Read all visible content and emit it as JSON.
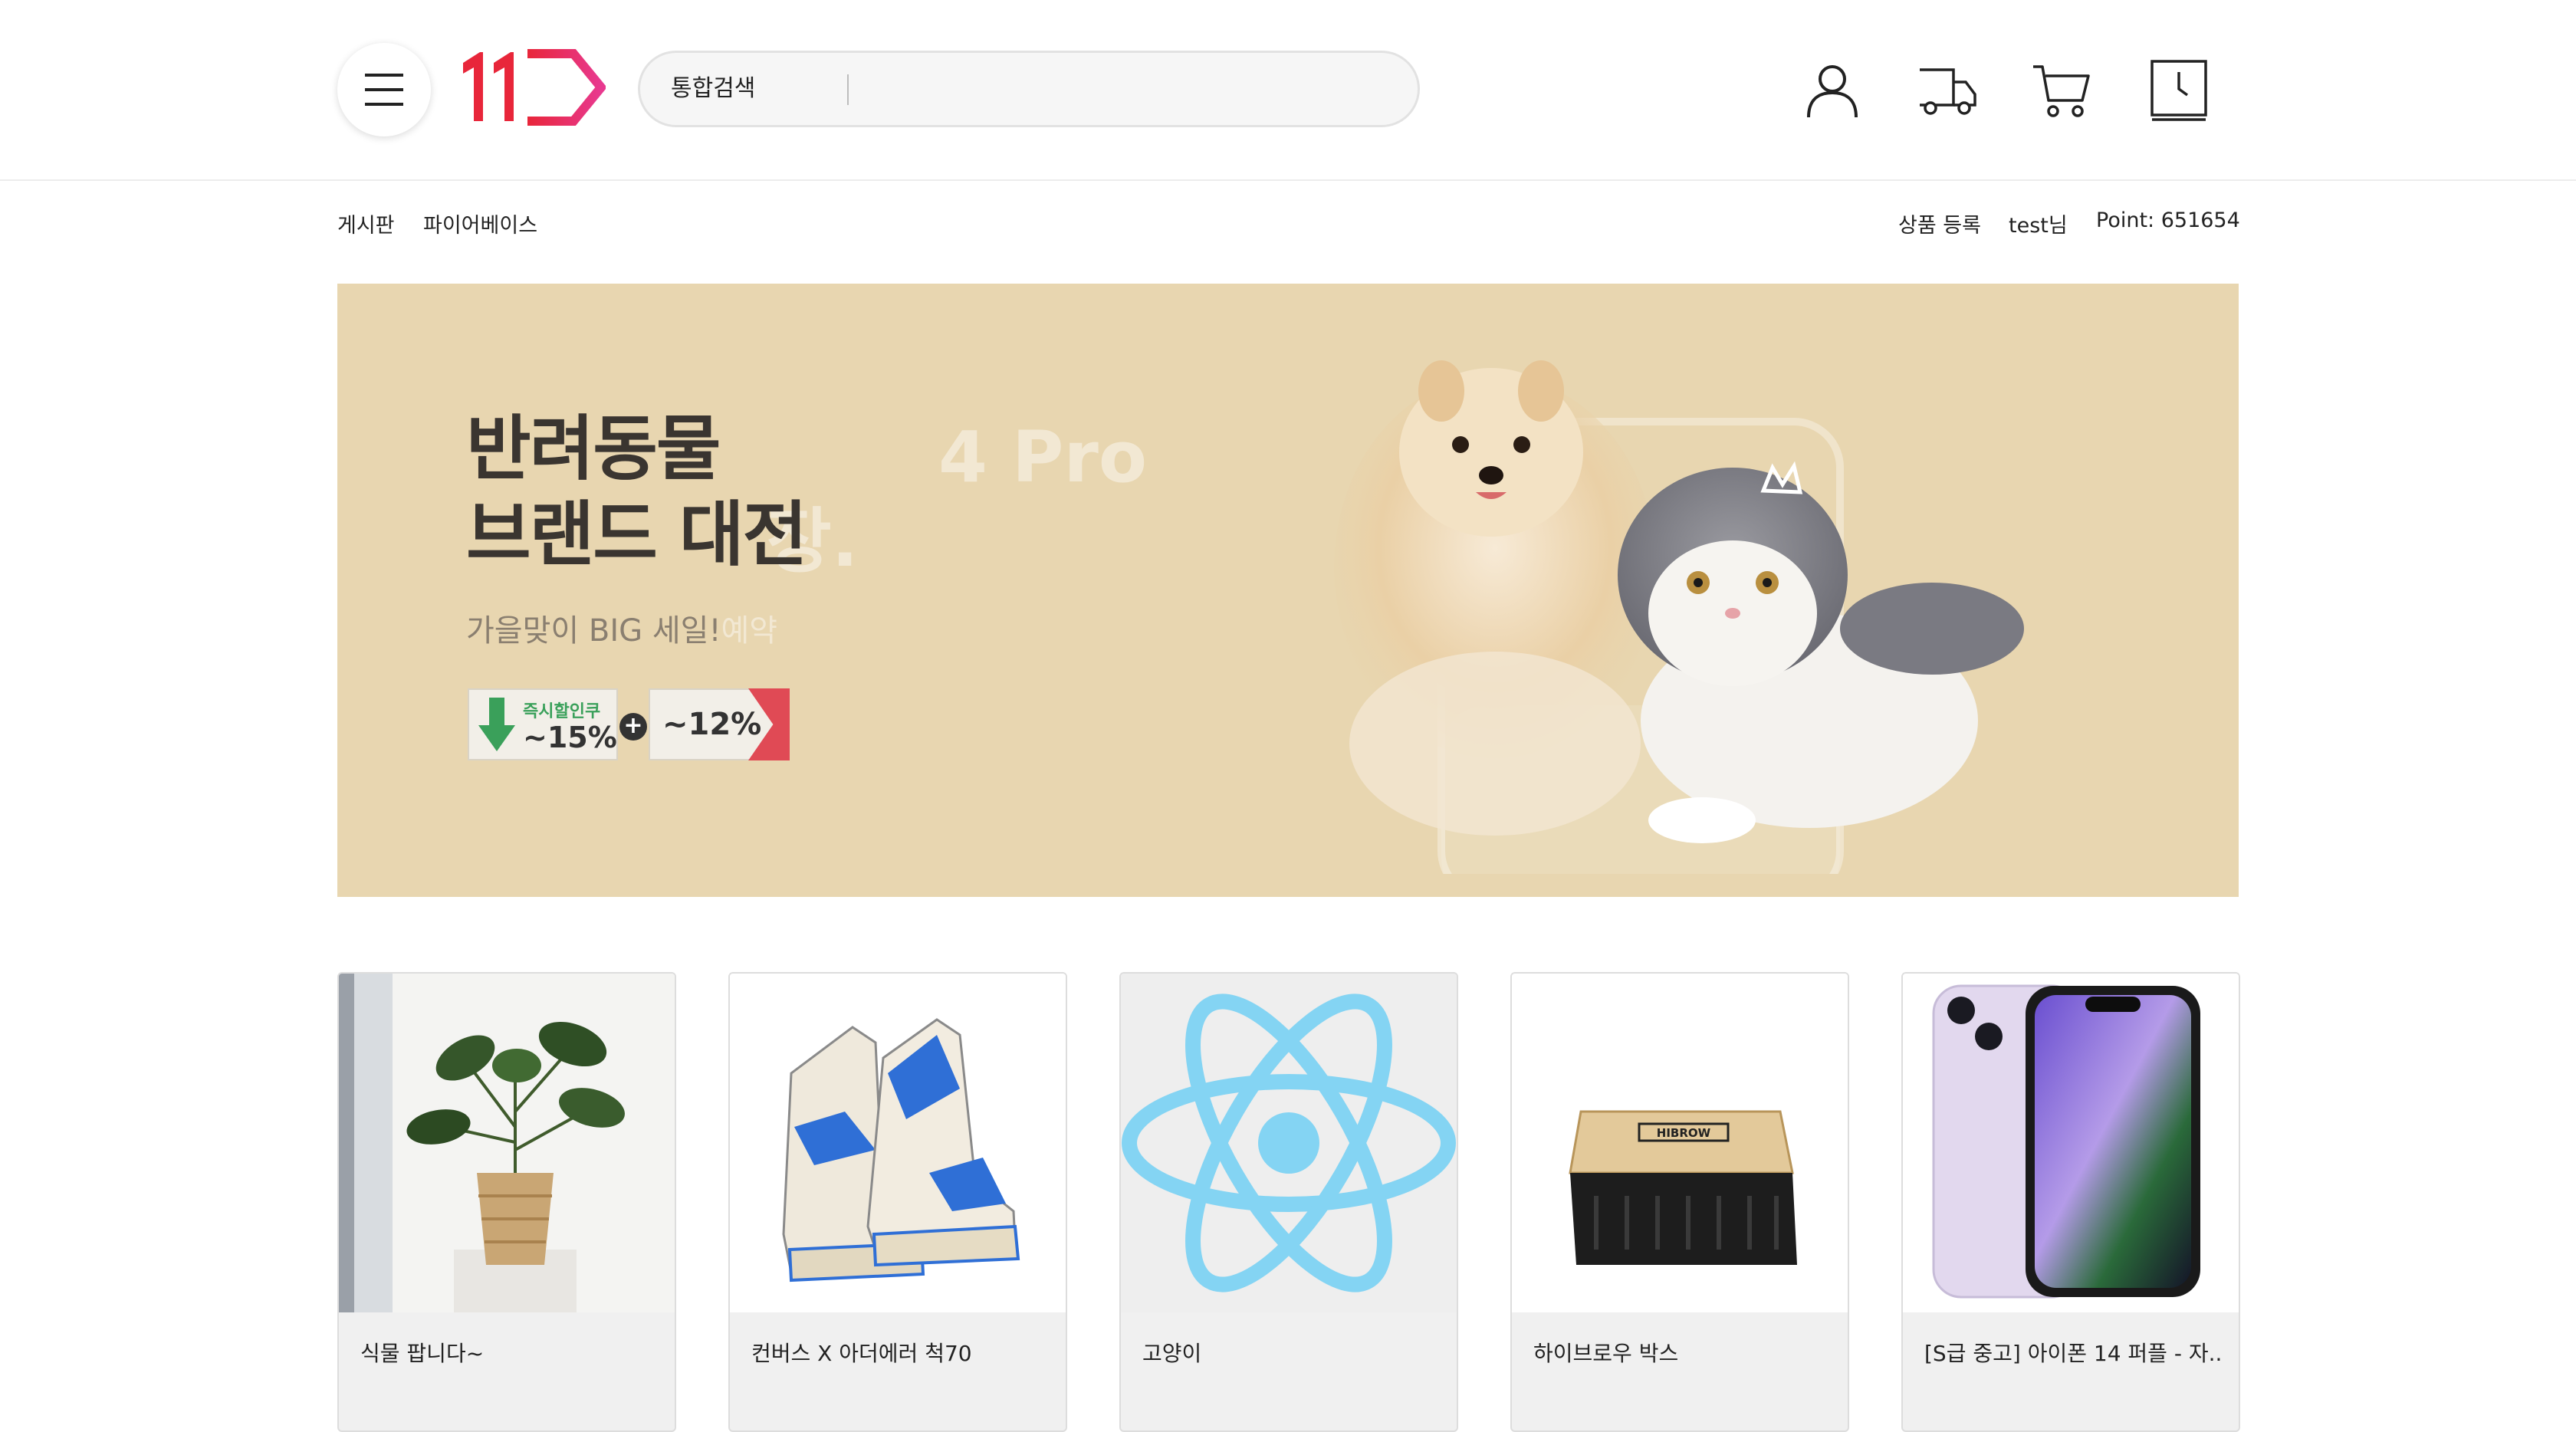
{
  "header": {
    "logo_text": "11",
    "search": {
      "label": "통합검색",
      "value": "",
      "placeholder": ""
    },
    "icons": [
      "user-icon",
      "truck-icon",
      "cart-icon",
      "recent-clock-icon"
    ]
  },
  "subnav": {
    "left": [
      "게시판",
      "파이어베이스"
    ],
    "right": {
      "register": "상품 등록",
      "user": "test님",
      "point": "Point: 651654"
    }
  },
  "banner": {
    "title_line1": "반려동물",
    "title_line2": "브랜드 대전",
    "ghost_title_line1": "4 Pro",
    "ghost_title_line2": "장.",
    "subtitle": "가을맞이 BIG 세일!",
    "subtitle_ghost": "예약",
    "coupon1_label": "즉시할인쿠",
    "coupon1_value": "~15%",
    "coupon_plus": "+",
    "coupon2_value": "~12%",
    "colors": {
      "background": "#e8d6b0",
      "coupon_green": "#3aa05a",
      "coupon_red": "#e04a55"
    }
  },
  "products": [
    {
      "name": "식물 팝니다~",
      "image": "plant-image"
    },
    {
      "name": "컨버스 X 아더에러 척70",
      "image": "sneakers-image"
    },
    {
      "name": "고양이",
      "image": "react-logo-image"
    },
    {
      "name": "하이브로우 박스",
      "image": "crate-box-image",
      "box_label": "HIBROW"
    },
    {
      "name": "[S급 중고] 아이폰 14 퍼플 - 자...",
      "image": "iphone-image"
    }
  ],
  "colors": {
    "logo_red": "#e8263a",
    "logo_pink": "#e8398f",
    "react_blue": "#84d4f3"
  }
}
